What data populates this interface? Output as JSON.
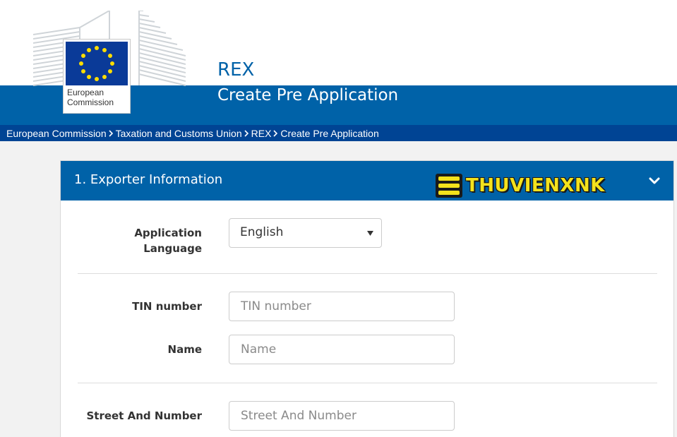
{
  "header": {
    "site_name": "REX",
    "page_heading": "Create Pre Application",
    "logo_line1": "European",
    "logo_line2": "Commission",
    "colors": {
      "band": "#0062a8",
      "breadcrumb": "#004494",
      "flag": "#0a3a98",
      "stars": "#ffdd00"
    }
  },
  "breadcrumb": {
    "items": [
      "European Commission",
      "Taxation and Customs Union",
      "REX",
      "Create Pre Application"
    ],
    "separator_icon": "chevron-right-icon"
  },
  "panel": {
    "title": "1. Exporter Information",
    "watermark": "THUVIENXNK",
    "toggle_icon": "chevron-down-icon"
  },
  "form": {
    "application_language": {
      "label_line1": "Application",
      "label_line2": "Language",
      "value": "English"
    },
    "tin_number": {
      "label": "TIN number",
      "placeholder": "TIN number",
      "value": ""
    },
    "name": {
      "label": "Name",
      "placeholder": "Name",
      "value": ""
    },
    "street_and_number": {
      "label": "Street And Number",
      "placeholder": "Street And Number",
      "value": ""
    }
  }
}
